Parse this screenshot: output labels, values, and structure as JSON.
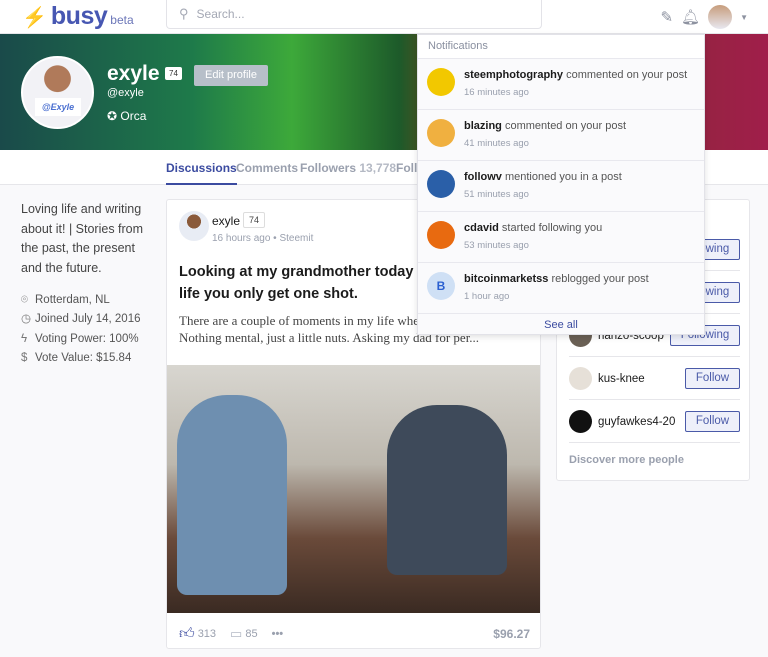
{
  "header": {
    "logo": "busy",
    "logo_badge": "beta",
    "search_placeholder": "Search...",
    "icons": [
      "write-icon",
      "bell-icon",
      "avatar",
      "chevron-down-icon"
    ]
  },
  "profile": {
    "name": "exyle",
    "reputation": "74",
    "handle": "@exyle",
    "rank": "Orca",
    "edit_label": "Edit profile",
    "avatar_sign": "@Exyle"
  },
  "tabs": [
    {
      "label": "Discussions",
      "active": true
    },
    {
      "label": "Comments"
    },
    {
      "label": "Followers",
      "count": "13,778"
    },
    {
      "label": "Following"
    }
  ],
  "bio": "Loving life and writing about it! | Stories from the past, the present and the future.",
  "meta": {
    "location": "Rotterdam, NL",
    "joined": "Joined July 14, 2016",
    "voting_power": "Voting Power: 100%",
    "vote_value": "Vote Value: $15.84"
  },
  "post": {
    "author": "exyle",
    "reputation": "74",
    "time": "16 hours ago",
    "app": "Steemit",
    "title": "Looking at my grandmother today I realized that in life you only get one shot.",
    "excerpt": "There are a couple of moments in my life where I go a little nuts. Nothing mental, just a little nuts. Asking my dad for per...",
    "likes": "313",
    "comments": "85",
    "payout": "$96.27"
  },
  "suggestions": {
    "people": [
      {
        "name": "",
        "button": "Following"
      },
      {
        "name": "",
        "button": "Following"
      },
      {
        "name": "hanzo-scoop",
        "button": "Following"
      },
      {
        "name": "kus-knee",
        "button": "Follow"
      },
      {
        "name": "guyfawkes4-20",
        "button": "Follow"
      }
    ],
    "discover": "Discover more people"
  },
  "notifications": {
    "title": "Notifications",
    "items": [
      {
        "user": "steemphotography",
        "action": "commented on your post",
        "time": "16 minutes ago",
        "avatar_color": "#f2c800"
      },
      {
        "user": "blazing",
        "action": "commented on your post",
        "time": "41 minutes ago",
        "avatar_color": "#f0b040"
      },
      {
        "user": "followv",
        "action": "mentioned you in a post",
        "time": "51 minutes ago",
        "avatar_color": "#2a5fa8"
      },
      {
        "user": "cdavid",
        "action": "started following you",
        "time": "53 minutes ago",
        "avatar_color": "#e86a10"
      },
      {
        "user": "bitcoinmarketss",
        "action": "reblogged your post",
        "time": "1 hour ago",
        "avatar_color": "#cfe0f5"
      }
    ],
    "see_all": "See all"
  },
  "colors": {
    "accent": "#3b4ba0",
    "follow_button": "#4a5aa8"
  }
}
